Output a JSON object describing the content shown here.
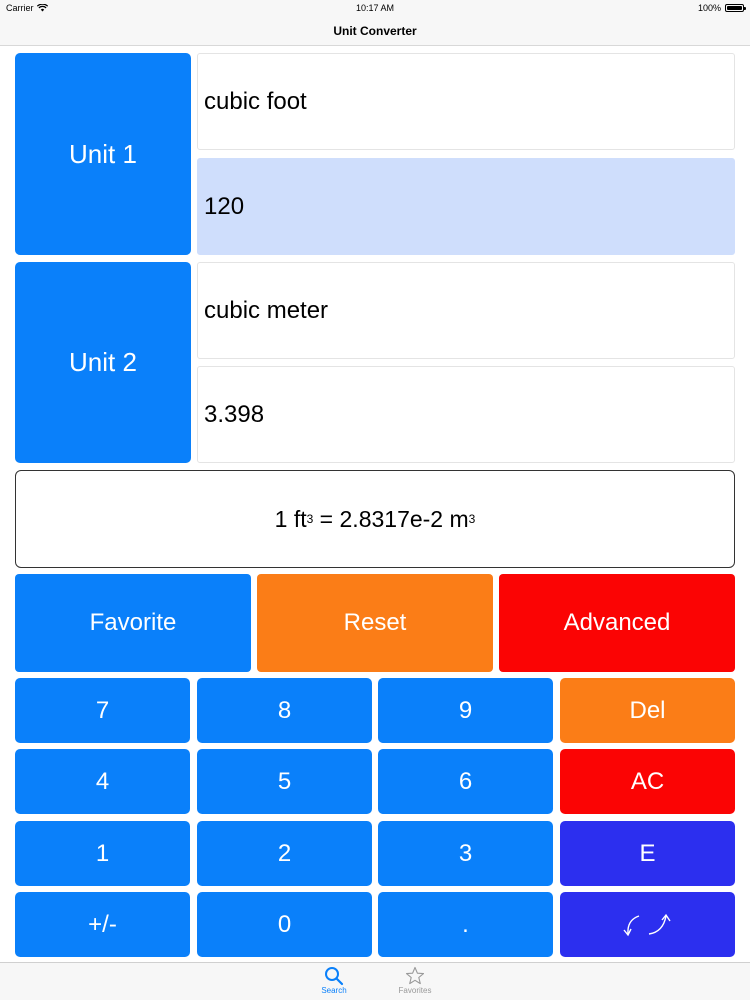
{
  "status_bar": {
    "carrier": "Carrier",
    "time": "10:17 AM",
    "battery": "100%"
  },
  "nav": {
    "title": "Unit Converter"
  },
  "unit1": {
    "button_label": "Unit 1",
    "name": "cubic foot",
    "value": "120"
  },
  "unit2": {
    "button_label": "Unit 2",
    "name": "cubic meter",
    "value": "3.398"
  },
  "formula": {
    "lhs_num": "1 ft",
    "lhs_exp": "3",
    "mid": " = 2.8317e-2 m",
    "rhs_exp": "3"
  },
  "actions": {
    "favorite": "Favorite",
    "reset": "Reset",
    "advanced": "Advanced"
  },
  "keypad": {
    "k7": "7",
    "k8": "8",
    "k9": "9",
    "del": "Del",
    "k4": "4",
    "k5": "5",
    "k6": "6",
    "ac": "AC",
    "k1": "1",
    "k2": "2",
    "k3": "3",
    "e": "E",
    "plusminus": "+/-",
    "k0": "0",
    "dot": "."
  },
  "tabs": {
    "search": "Search",
    "favorites": "Favorites"
  },
  "colors": {
    "blue": "#0a80fa",
    "orange": "#fb7d17",
    "red": "#fb0404",
    "indigo": "#2c2fef",
    "selected_field": "#cfdefc"
  },
  "icons": {
    "swap": "swap-arrows-icon",
    "search": "magnifier-icon",
    "favorites": "star-icon",
    "wifi": "wifi-icon"
  }
}
